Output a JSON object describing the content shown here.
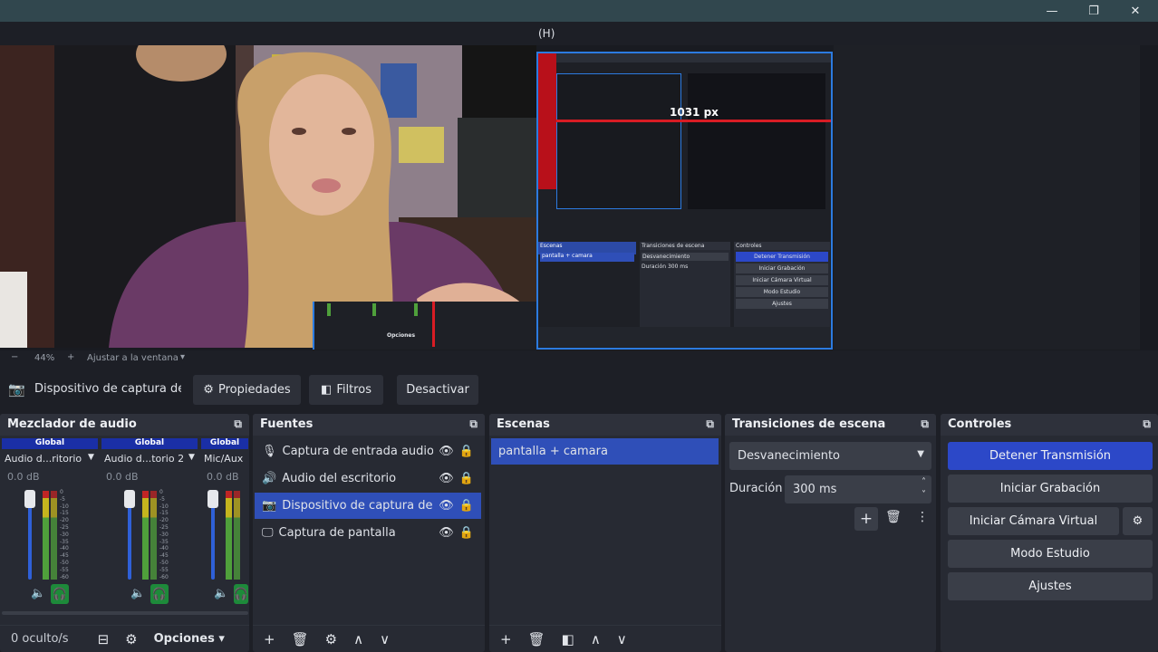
{
  "preview": {
    "menu_fragment": "(H)",
    "nested_measure": "1031 px",
    "nested_docks": {
      "scenes_title": "Escenas",
      "scene_item": "pantalla + camara",
      "transitions_title": "Transiciones de escena",
      "transition_value": "Desvanecimiento",
      "duration_label": "Duración",
      "duration_value": "300 ms",
      "controls_title": "Controles",
      "controls": [
        "Detener Transmisión",
        "Iniciar Grabación",
        "Iniciar Cámara Virtual",
        "Modo Estudio",
        "Ajustes"
      ],
      "mixer_foot": "Opciones"
    }
  },
  "zoombar": {
    "zoom": "44%",
    "fit": "Ajustar a la ventana"
  },
  "source_toolbar": {
    "selected_source": "Dispositivo de captura de v",
    "properties": "Propiedades",
    "filters": "Filtros",
    "deactivate": "Desactivar"
  },
  "mixer": {
    "title": "Mezclador de audio",
    "channels": [
      {
        "group": "Global",
        "name": "Audio d...ritorio",
        "db": "0.0 dB",
        "volume": 1.0
      },
      {
        "group": "Global",
        "name": "Audio d...torio 2",
        "db": "0.0 dB",
        "volume": 1.0
      },
      {
        "group": "Global",
        "name": "Mic/Aux",
        "db": "0.0 dB",
        "volume": 1.0
      }
    ],
    "ticks": [
      "0",
      "-5",
      "-10",
      "-15",
      "-20",
      "-25",
      "-30",
      "-35",
      "-40",
      "-45",
      "-50",
      "-55",
      "-60"
    ],
    "footer_status": "0 oculto/s",
    "options": "Opciones"
  },
  "sources": {
    "title": "Fuentes",
    "items": [
      {
        "label": "Captura de entrada audio",
        "icon": "microphone-icon"
      },
      {
        "label": "Audio del escritorio",
        "icon": "speaker-icon"
      },
      {
        "label": "Dispositivo de captura de v",
        "icon": "camera-icon"
      },
      {
        "label": "Captura de pantalla",
        "icon": "monitor-icon"
      }
    ]
  },
  "scenes": {
    "title": "Escenas",
    "items": [
      "pantalla + camara"
    ]
  },
  "transitions": {
    "title": "Transiciones de escena",
    "type": "Desvanecimiento",
    "duration_label": "Duración",
    "duration": "300 ms"
  },
  "controls": {
    "title": "Controles",
    "stop_stream": "Detener Transmisión",
    "start_recording": "Iniciar Grabación",
    "start_virtual_cam": "Iniciar Cámara Virtual",
    "studio_mode": "Modo Estudio",
    "settings": "Ajustes"
  },
  "colors": {
    "accent": "#2f4fb8",
    "stop_button": "#2c48c8",
    "titlebar": "#31474e",
    "meter_green": "#4fa03b",
    "meter_red": "#c02525"
  }
}
